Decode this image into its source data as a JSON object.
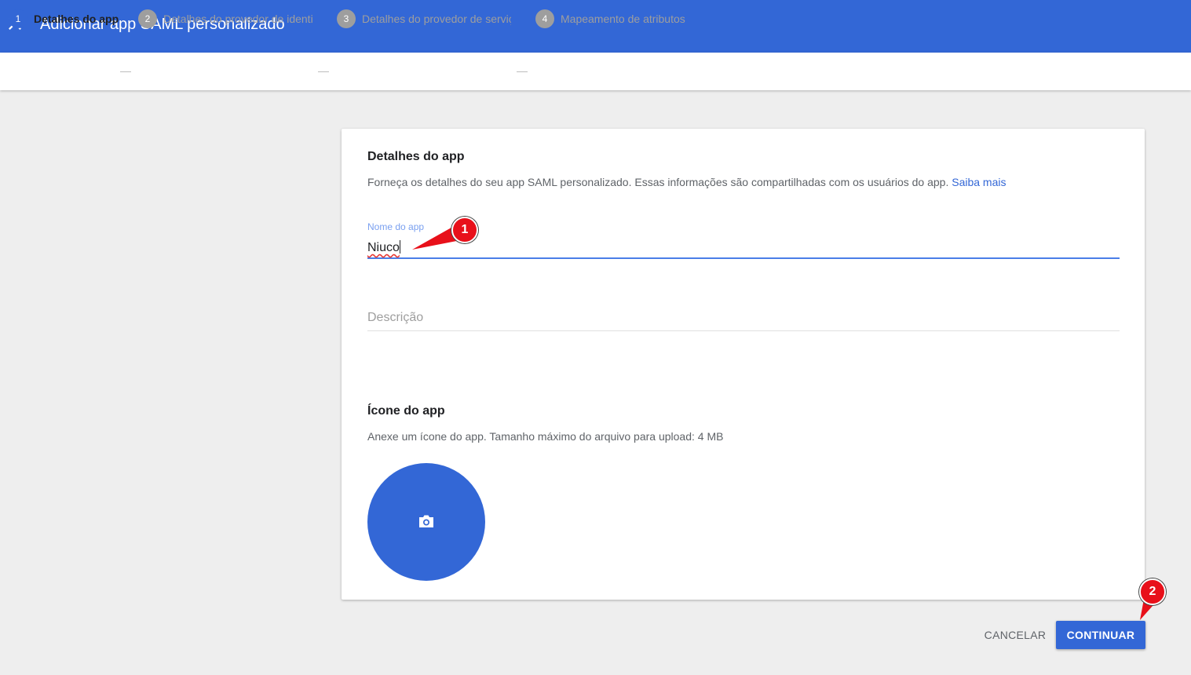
{
  "header": {
    "title": "Adicionar app SAML personalizado",
    "close_icon": "close-icon"
  },
  "stepper": {
    "steps": [
      {
        "num": "1",
        "label": "Detalhes do app",
        "active": true
      },
      {
        "num": "2",
        "label": "Detalhes do provedor de identi",
        "active": false
      },
      {
        "num": "3",
        "label": "Detalhes do provedor de serviç",
        "active": false
      },
      {
        "num": "4",
        "label": "Mapeamento de atributos",
        "active": false
      }
    ]
  },
  "card": {
    "details_title": "Detalhes do app",
    "details_desc": "Forneça os detalhes do seu app SAML personalizado. Essas informações são compartilhadas com os usuários do app.",
    "learn_more": "Saiba mais",
    "app_name_label": "Nome do app",
    "app_name_value": "Niuco",
    "description_placeholder": "Descrição",
    "icon_title": "Ícone do app",
    "icon_desc": "Anexe um ícone do app. Tamanho máximo do arquivo para upload: 4 MB",
    "upload_icon": "camera-icon"
  },
  "actions": {
    "cancel": "CANCELAR",
    "continue": "CONTINUAR"
  },
  "annotations": {
    "badge1": "1",
    "badge2": "2"
  },
  "colors": {
    "primary": "#3367d6",
    "annotation": "#e8101a"
  }
}
